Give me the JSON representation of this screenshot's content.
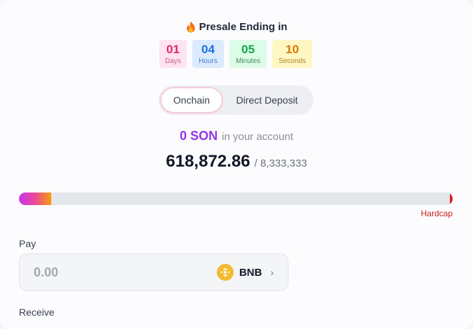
{
  "presale": {
    "title": "Presale Ending in",
    "countdown": [
      {
        "value": "01",
        "unit": "Days"
      },
      {
        "value": "04",
        "unit": "Hours"
      },
      {
        "value": "05",
        "unit": "Minutes"
      },
      {
        "value": "10",
        "unit": "Seconds"
      }
    ]
  },
  "tabs": {
    "onchain": "Onchain",
    "direct_deposit": "Direct Deposit",
    "active": "Onchain"
  },
  "account": {
    "balance": "0 SON",
    "suffix": "in your account"
  },
  "progress": {
    "raised": "618,872.86",
    "cap": "/ 8,333,333",
    "hardcap_label": "Hardcap",
    "fill_fraction": 0.074
  },
  "pay": {
    "label": "Pay",
    "placeholder": "0.00",
    "token": "BNB",
    "token_icon": "bnb-coin-icon",
    "chevron": "›"
  },
  "receive": {
    "label": "Receive"
  },
  "icons": {
    "title": "fire-icon"
  },
  "colors": {
    "balance": "#9333ea",
    "hardcap": "#c81e1e",
    "progress_gradient": [
      "#c436e8",
      "#ec4899",
      "#f59e0b"
    ],
    "bnb": "#f3ba2f"
  }
}
